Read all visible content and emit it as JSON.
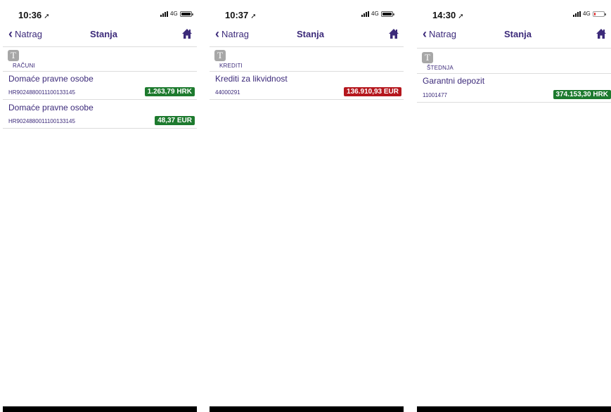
{
  "screens": [
    {
      "time": "10:36",
      "network": "4G",
      "nav": {
        "back_label": "Natrag",
        "title": "Stanja"
      },
      "section": {
        "icon_letter": "T",
        "label": "RAČUNI"
      },
      "items": [
        {
          "name": "Domaće pravne osobe",
          "number": "HR9024880011100133145",
          "amount": "1.263,79 HRK",
          "status": "positive"
        },
        {
          "name": "Domaće pravne osobe",
          "number": "HR9024880011100133145",
          "amount": "48,37 EUR",
          "status": "positive"
        }
      ],
      "battery": "full"
    },
    {
      "time": "10:37",
      "network": "4G",
      "nav": {
        "back_label": "Natrag",
        "title": "Stanja"
      },
      "section": {
        "icon_letter": "T",
        "label": "KREDITI"
      },
      "items": [
        {
          "name": "Krediti za likvidnost",
          "number": "44000291",
          "amount": "136.910,93 EUR",
          "status": "negative"
        }
      ],
      "battery": "full"
    },
    {
      "time": "14:30",
      "network": "4G",
      "nav": {
        "back_label": "Natrag",
        "title": "Stanja"
      },
      "section": {
        "icon_letter": "T",
        "label": "ŠTEDNJA"
      },
      "items": [
        {
          "name": "Garantni depozit",
          "number": "11001477",
          "amount": "374.153,30 HRK",
          "status": "positive"
        }
      ],
      "battery": "low"
    }
  ],
  "colors": {
    "brand_purple": "#3c2a7a",
    "positive_badge": "#1d7a2e",
    "negative_badge": "#b5171d",
    "section_icon": "#a7a7a7"
  },
  "icons": {
    "back": "chevron-left-icon",
    "home": "home-icon",
    "location": "location-arrow-icon",
    "signal": "signal-icon",
    "battery": "battery-icon"
  }
}
